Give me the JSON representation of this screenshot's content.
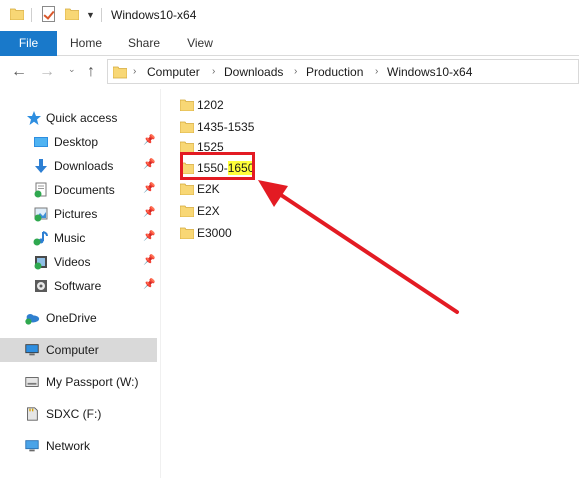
{
  "window": {
    "title": "Windows10-x64"
  },
  "ribbon": {
    "tabs": [
      "File",
      "Home",
      "Share",
      "View"
    ]
  },
  "address": {
    "crumbs": [
      "Computer",
      "Downloads",
      "Production",
      "Windows10-x64"
    ]
  },
  "nav": {
    "quick_access": "Quick access",
    "pinned": [
      {
        "label": "Desktop",
        "icon": "desktop-icon"
      },
      {
        "label": "Downloads",
        "icon": "download-arrow-icon"
      },
      {
        "label": "Documents",
        "icon": "documents-icon"
      },
      {
        "label": "Pictures",
        "icon": "pictures-icon"
      },
      {
        "label": "Music",
        "icon": "music-icon"
      },
      {
        "label": "Videos",
        "icon": "videos-icon"
      },
      {
        "label": "Software",
        "icon": "software-icon"
      }
    ],
    "onedrive": "OneDrive",
    "computer": "Computer",
    "passport": "My Passport (W:)",
    "sdxc": "SDXC (F:)",
    "network": "Network"
  },
  "files": [
    {
      "name": "1202"
    },
    {
      "name": "1435-1535"
    },
    {
      "name": "1525"
    },
    {
      "name_a": "1550-",
      "name_b": "1650"
    },
    {
      "name": "E2K"
    },
    {
      "name": "E2X"
    },
    {
      "name": "E3000"
    }
  ],
  "colors": {
    "accent": "#1979ca",
    "folder": "#f8d775",
    "highlight": "#ffff3b",
    "annotation": "#e31b23",
    "selected_bg": "#d9d9d9"
  }
}
